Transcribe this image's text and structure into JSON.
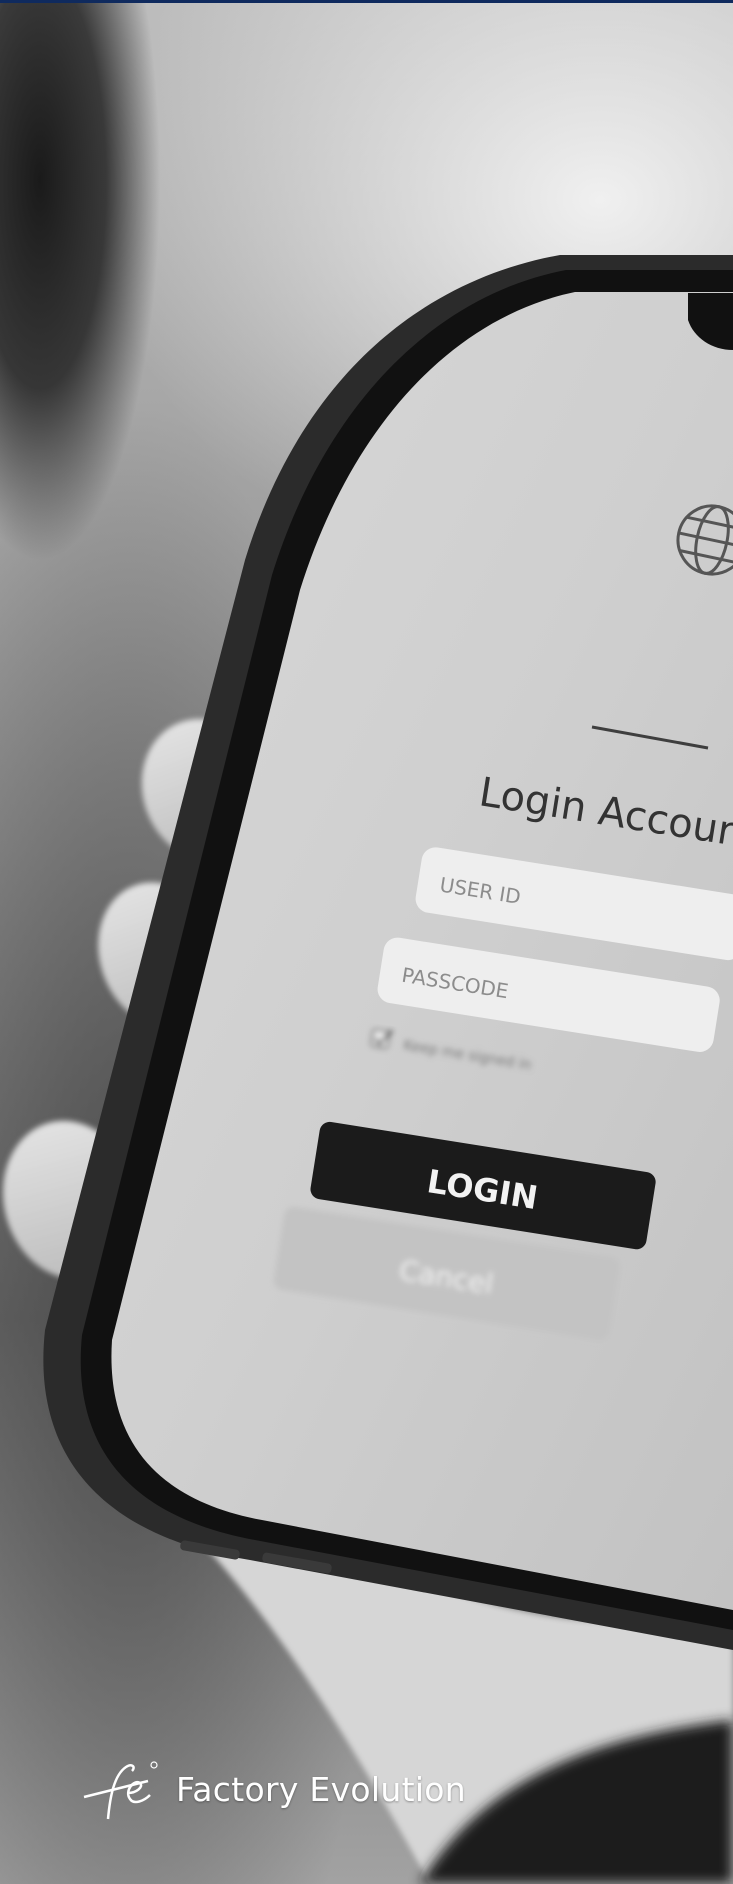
{
  "phone_screen": {
    "title": "Login Accour",
    "user_id_placeholder": "USER ID",
    "passcode_placeholder": "PASSCODE",
    "keep_signed_in_label": "Keep me signed in",
    "login_label": "LOGIN",
    "cancel_label": "Cancel"
  },
  "brand": {
    "logo_letters": "fe",
    "name": "Factory Evolution"
  },
  "colors": {
    "top_bar": "#0f2a5e",
    "login_button": "#1b1b1b",
    "brand_text": "#ffffff"
  },
  "icons": {
    "globe": "globe-icon",
    "checkbox": "checkbox-checked-icon",
    "logo": "fe-logo-icon"
  }
}
